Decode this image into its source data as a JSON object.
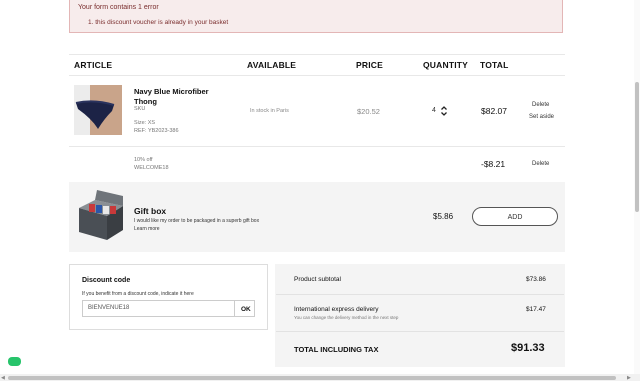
{
  "error": {
    "title": "Your form contains 1 error",
    "item": "1. this discount voucher is already in your basket"
  },
  "table": {
    "headers": [
      "ARTICLE",
      "AVAILABLE",
      "PRICE",
      "QUANTITY",
      "TOTAL"
    ]
  },
  "product": {
    "name": "Navy Blue Microfiber Thong",
    "sku": "SKU",
    "size": "Size: XS",
    "ref": "REF: YB2023-386",
    "availability": "In stock in Paris",
    "price": "$20.52",
    "quantity": "4",
    "total": "$82.07",
    "delete_label": "Delete",
    "set_aside_label": "Set aside"
  },
  "discount_line": {
    "label": "10% off",
    "code": "WELCOME18",
    "total": "-$8.21",
    "delete_label": "Delete"
  },
  "gift_box": {
    "title": "Gift box",
    "description": "I would like my order to be packaged in a superb gift box",
    "learn_more": "Learn more",
    "price": "$5.86",
    "add_label": "ADD"
  },
  "discount_code": {
    "title": "Discount code",
    "help": "If you benefit from a discount code, indicate it here",
    "value": "BIENVENUE18",
    "ok_label": "OK"
  },
  "summary": {
    "subtotal_label": "Product subtotal",
    "subtotal_value": "$73.86",
    "delivery_label": "International express delivery",
    "delivery_note": "You can change the delivery method in the next step",
    "delivery_value": "$17.47",
    "total_label": "TOTAL INCLUDING TAX",
    "total_value": "$91.33"
  },
  "colors": {
    "error_bg": "#f7ecec",
    "error_text": "#7a2d2d",
    "chat_badge": "#27c46b"
  },
  "icons": [
    "quantity-stepper-icon",
    "product-thumbnail",
    "gift-box-image",
    "chat-icon"
  ]
}
